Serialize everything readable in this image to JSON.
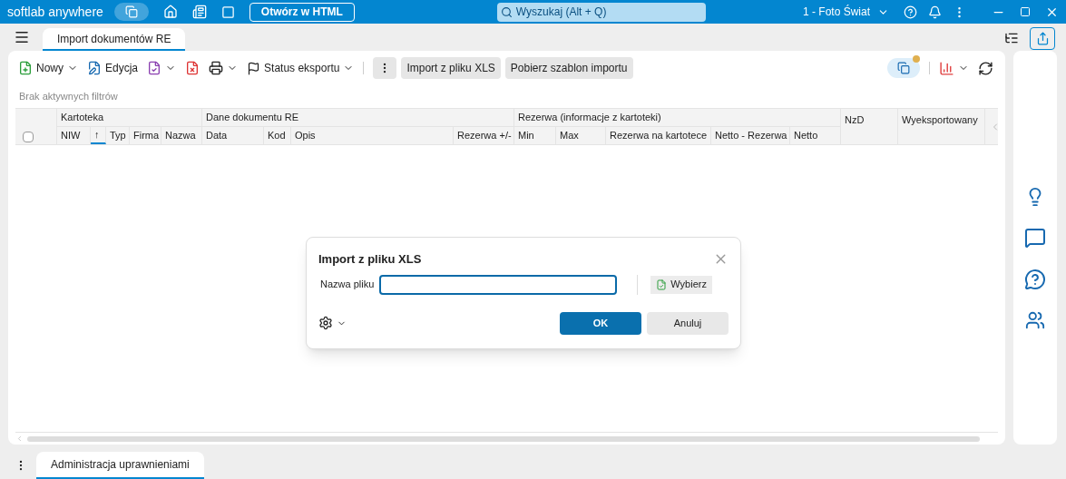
{
  "topbar": {
    "app_name": "softlab anywhere",
    "html_button": "Otwórz w HTML",
    "search_placeholder": "Wyszukaj (Alt + Q)",
    "company": "1 - Foto Świat"
  },
  "tabs": [
    {
      "label": "Import dokumentów RE",
      "selected": true
    }
  ],
  "toolbar": {
    "new": "Nowy",
    "edit": "Edycja",
    "status": "Status eksportu",
    "import": "Import z pliku XLS",
    "template": "Pobierz szablon importu",
    "notification": true
  },
  "filters": "Brak aktywnych filtrów",
  "table": {
    "select_all": {
      "checked": false
    },
    "groups": [
      {
        "label": "Kartoteka"
      },
      {
        "label": "Dane dokumentu RE"
      },
      {
        "label": "Rezerwa (informacje z kartoteki)"
      }
    ],
    "columns": [
      {
        "label": "NIW"
      },
      {
        "label": "↑",
        "sorted": true
      },
      {
        "label": "Typ"
      },
      {
        "label": "Firma"
      },
      {
        "label": "Nazwa"
      },
      {
        "label": "Data"
      },
      {
        "label": "Kod"
      },
      {
        "label": "Opis"
      },
      {
        "label": "Rezerwa +/-"
      },
      {
        "label": "Min"
      },
      {
        "label": "Max"
      },
      {
        "label": "Rezerwa na kartotece"
      },
      {
        "label": "Netto - Rezerwa"
      },
      {
        "label": "Netto"
      }
    ],
    "single_columns": [
      {
        "label": "NzD"
      },
      {
        "label": "Wyeksportowany"
      }
    ]
  },
  "dialog": {
    "title": "Import z pliku XLS",
    "field_label": "Nazwa pliku",
    "choose": "Wybierz",
    "ok": "OK",
    "cancel": "Anuluj"
  },
  "bottom_tabs": [
    {
      "label": "Administracja uprawnieniami",
      "selected": true
    }
  ]
}
